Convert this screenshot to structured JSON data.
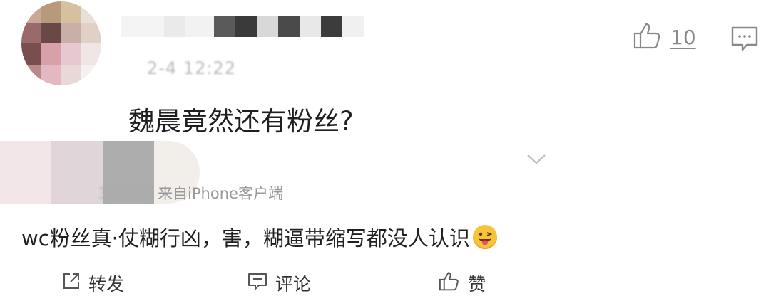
{
  "top_comment": {
    "text": "魏晨竟然还有粉丝?",
    "time": "2-4 12:22",
    "like_count": "10"
  },
  "second_post": {
    "time_ago": "3分钟前",
    "source": "来自iPhone客户端",
    "text": "wc粉丝真·仗糊行凶，害，糊逼带缩写都没人认识"
  },
  "actions": {
    "forward": "转发",
    "comment": "评论",
    "like": "赞"
  },
  "colors": {
    "text": "#1f1f1f",
    "meta": "#999999",
    "icon": "#888888"
  },
  "icons": [
    "thumbs-up-icon",
    "reply-icon",
    "chevron-down-icon",
    "share-icon",
    "comment-icon",
    "emoji-icon"
  ]
}
